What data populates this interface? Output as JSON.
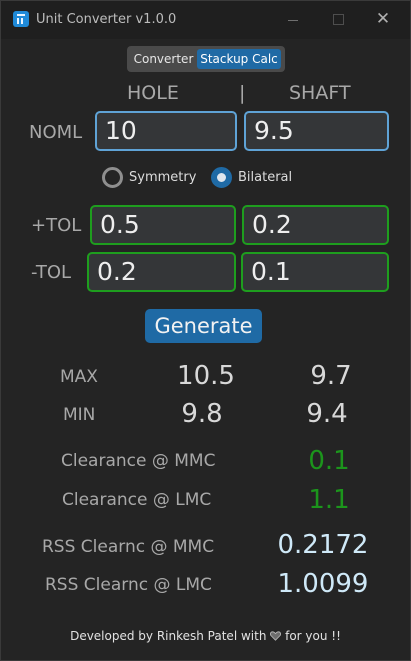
{
  "window": {
    "title": "Unit Converter v1.0.0",
    "close_glyph": "✕"
  },
  "tabs": [
    {
      "label": "Converter",
      "selected": false
    },
    {
      "label": "Stackup Calc",
      "selected": true
    }
  ],
  "headers": {
    "hole": "HOLE",
    "separator": "|",
    "shaft": "SHAFT"
  },
  "rows": {
    "noml": {
      "label": "NOML",
      "hole": "10",
      "shaft": "9.5"
    },
    "plus_tol": {
      "label": "+TOL",
      "hole": "0.5",
      "shaft": "0.2"
    },
    "minus_tol": {
      "label": "-TOL",
      "hole": "0.2",
      "shaft": "0.1"
    }
  },
  "tolerance_mode": {
    "options": [
      {
        "label": "Symmetry",
        "selected": false
      },
      {
        "label": "Bilateral",
        "selected": true
      }
    ]
  },
  "generate_label": "Generate",
  "results": {
    "max": {
      "label": "MAX",
      "hole": "10.5",
      "shaft": "9.7"
    },
    "min": {
      "label": "MIN",
      "hole": "9.8",
      "shaft": "9.4"
    },
    "clearance_mmc": {
      "label": "Clearance @ MMC",
      "value": "0.1"
    },
    "clearance_lmc": {
      "label": "Clearance @ LMC",
      "value": "1.1"
    },
    "rss_mmc": {
      "label": "RSS Clearnc @ MMC",
      "value": "0.2172"
    },
    "rss_lmc": {
      "label": "RSS Clearnc @ LMC",
      "value": "1.0099"
    }
  },
  "footer": {
    "prefix": "Developed by Rinkesh Patel with",
    "icon": "heart-icon",
    "suffix": "for you !!"
  },
  "colors": {
    "accent": "#1f6aa5",
    "valid_border": "#1e9e1e",
    "focus_border": "#5fa3d6",
    "clearance_text": "#1c951c"
  }
}
